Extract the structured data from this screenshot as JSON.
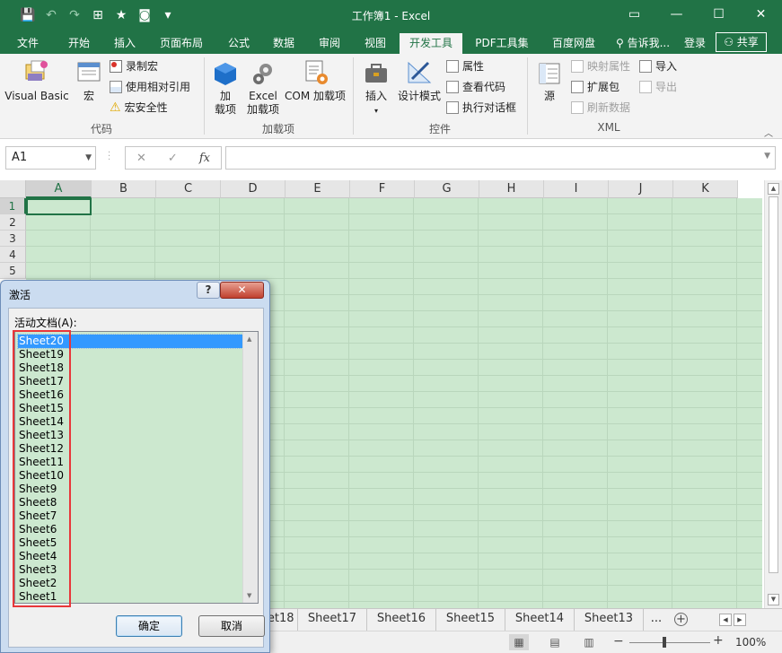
{
  "window": {
    "title": "工作簿1 - Excel",
    "controls": [
      "▭",
      "—",
      "☐",
      "✕"
    ]
  },
  "qat": {
    "save": "💾",
    "undo": "↶",
    "redo": "↷",
    "more": "▾"
  },
  "tabs": {
    "items": [
      "文件",
      "开始",
      "插入",
      "页面布局",
      "公式",
      "数据",
      "审阅",
      "视图",
      "开发工具",
      "PDF工具集",
      "百度网盘"
    ],
    "active": "开发工具",
    "tell_me": "告诉我...",
    "login": "登录",
    "share": "共享"
  },
  "ribbon": {
    "code": {
      "visual_basic": "Visual Basic",
      "macro": "宏",
      "record_macro": "录制宏",
      "relative_ref": "使用相对引用",
      "macro_security": "宏安全性",
      "label": "代码"
    },
    "addins": {
      "addin_line1": "加",
      "addin_line2": "载项",
      "excel_addin_line1": "Excel",
      "excel_addin_line2": "加载项",
      "com_addin": "COM 加载项",
      "label": "加载项"
    },
    "controls": {
      "insert": "插入",
      "design_mode": "设计模式",
      "properties": "属性",
      "view_code": "查看代码",
      "run_dialog": "执行对话框",
      "label": "控件"
    },
    "xml": {
      "source": "源",
      "map_properties": "映射属性",
      "expansion_packs": "扩展包",
      "refresh_data": "刷新数据",
      "import": "导入",
      "export": "导出",
      "label": "XML"
    }
  },
  "formula_bar": {
    "name_box": "A1",
    "cancel": "✕",
    "enter": "✓",
    "fx": "fx",
    "formula": ""
  },
  "grid": {
    "columns": [
      "A",
      "B",
      "C",
      "D",
      "E",
      "F",
      "G",
      "H",
      "I",
      "J",
      "K"
    ],
    "rows": [
      "1",
      "2",
      "3",
      "4",
      "5"
    ]
  },
  "sheet_tabs": {
    "items": [
      "Sheet18",
      "Sheet17",
      "Sheet16",
      "Sheet15",
      "Sheet14",
      "Sheet13"
    ],
    "more": "...",
    "add": "+"
  },
  "status": {
    "zoom": "100%"
  },
  "dialog": {
    "title": "激活",
    "help": "?",
    "close": "✕",
    "list_label": "活动文档(A):",
    "items": [
      "Sheet20",
      "Sheet19",
      "Sheet18",
      "Sheet17",
      "Sheet16",
      "Sheet15",
      "Sheet14",
      "Sheet13",
      "Sheet12",
      "Sheet11",
      "Sheet10",
      "Sheet9",
      "Sheet8",
      "Sheet7",
      "Sheet6",
      "Sheet5",
      "Sheet4",
      "Sheet3",
      "Sheet2",
      "Sheet1"
    ],
    "selected": "Sheet20",
    "ok": "确定",
    "cancel": "取消"
  },
  "colors": {
    "excel_green": "#217346",
    "cell_bg": "#cce8cf",
    "highlight": "#e8373a",
    "selection": "#3399ff"
  }
}
